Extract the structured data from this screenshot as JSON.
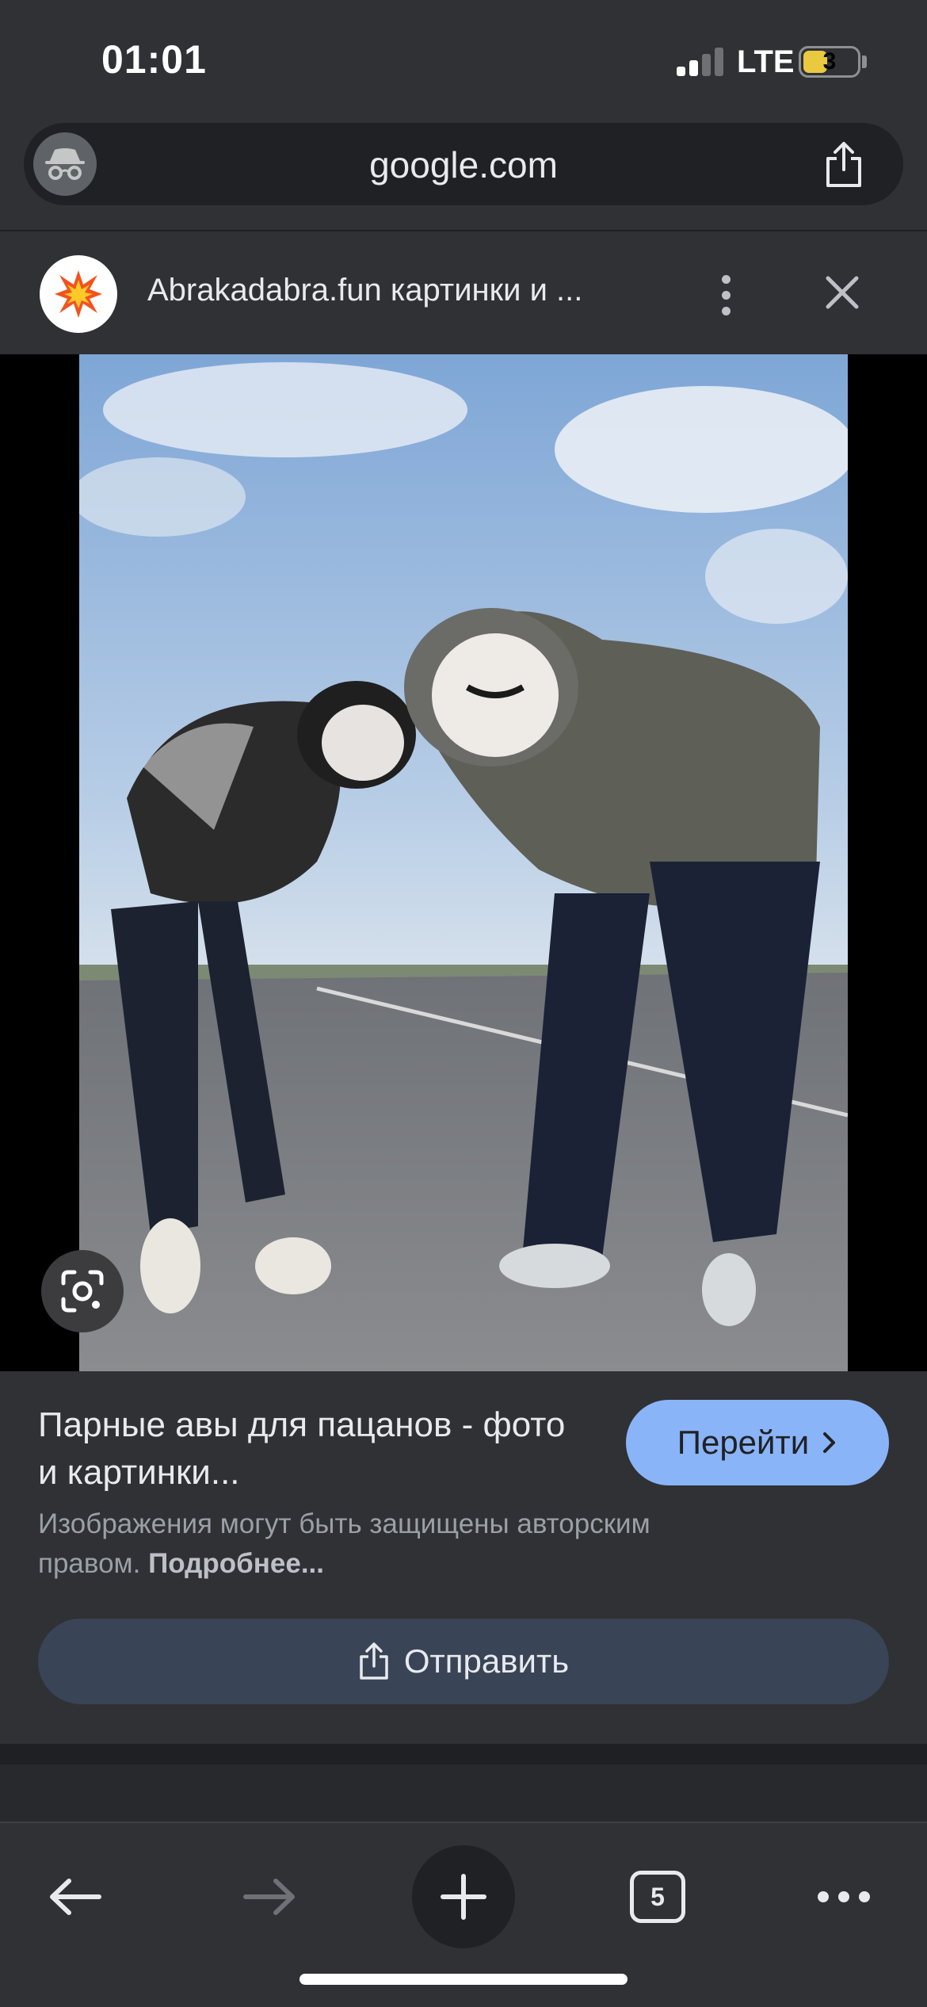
{
  "status_bar": {
    "time": "01:01",
    "network": "LTE",
    "battery_level": "3"
  },
  "url_bar": {
    "url": "google.com",
    "incognito_icon": "incognito-icon",
    "share_icon": "share-icon"
  },
  "source": {
    "title": "Abrakadabra.fun картинки и ...",
    "favicon": "explosion-favicon-icon"
  },
  "image": {
    "lens_icon": "google-lens-icon"
  },
  "result": {
    "title": "Парные авы для пацанов - фото и картинки...",
    "visit_label": "Перейти",
    "copyright_text": "Изображения могут быть защищены авторским правом.",
    "more_link": "Подробнее...",
    "send_label": "Отправить"
  },
  "toolbar": {
    "tab_count": "5"
  },
  "colors": {
    "background": "#303134",
    "accent_button": "#8ab4f8",
    "send_button": "#394457"
  }
}
